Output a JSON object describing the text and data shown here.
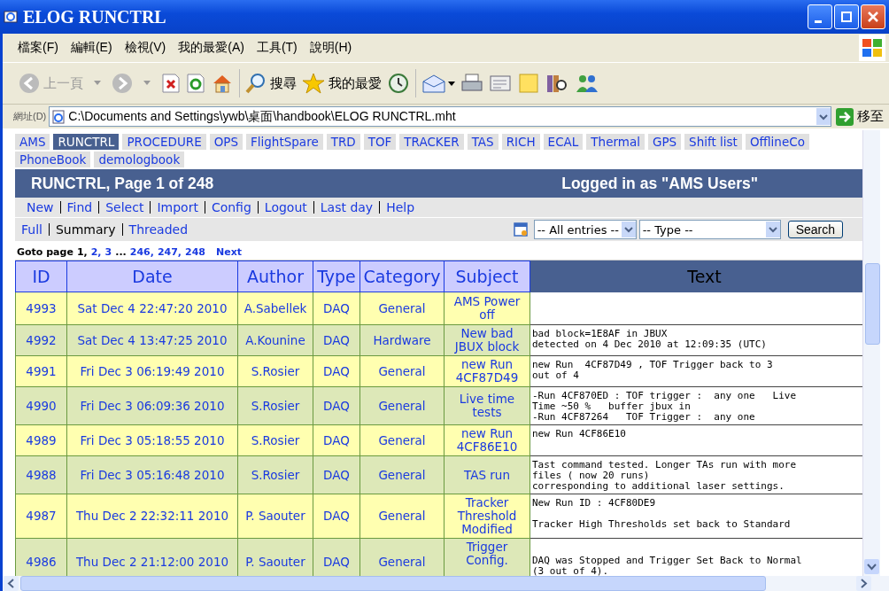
{
  "window": {
    "title": "ELOG RUNCTRL"
  },
  "menu": [
    "檔案(F)",
    "編輯(E)",
    "檢視(V)",
    "我的最愛(A)",
    "工具(T)",
    "說明(H)"
  ],
  "toolbar": {
    "back": {
      "label": "上一頁",
      "disabled": true
    },
    "search": "搜尋",
    "favorites": "我的最愛"
  },
  "address": {
    "label": "網址(D)",
    "value": "C:\\Documents and Settings\\ywb\\桌面\\handbook\\ELOG RUNCTRL.mht",
    "go": "移至"
  },
  "logbooks": [
    {
      "label": "AMS",
      "selected": false
    },
    {
      "label": "RUNCTRL",
      "selected": true
    },
    {
      "label": "PROCEDURE",
      "selected": false
    },
    {
      "label": "OPS",
      "selected": false
    },
    {
      "label": "FlightSpare",
      "selected": false
    },
    {
      "label": "TRD",
      "selected": false
    },
    {
      "label": "TOF",
      "selected": false
    },
    {
      "label": "TRACKER",
      "selected": false
    },
    {
      "label": "TAS",
      "selected": false
    },
    {
      "label": "RICH",
      "selected": false
    },
    {
      "label": "ECAL",
      "selected": false
    },
    {
      "label": "Thermal",
      "selected": false
    },
    {
      "label": "GPS",
      "selected": false
    },
    {
      "label": "Shift list",
      "selected": false
    },
    {
      "label": "OfflineCo",
      "selected": false
    },
    {
      "label": "PhoneBook",
      "selected": false
    },
    {
      "label": "demologbook",
      "selected": false
    }
  ],
  "header": {
    "title": "RUNCTRL, Page 1 of 248",
    "user": "Logged in as \"AMS Users\""
  },
  "commands": [
    "New",
    "Find",
    "Select",
    "Import",
    "Config",
    "Logout",
    "Last day",
    "Help"
  ],
  "views": [
    {
      "label": "Full",
      "selected": false
    },
    {
      "label": "Summary",
      "selected": true
    },
    {
      "label": "Threaded",
      "selected": false
    }
  ],
  "filters": [
    {
      "value": "-- All entries --"
    },
    {
      "value": "-- Type --"
    }
  ],
  "search_button": "Search",
  "goto": {
    "label": "Goto page",
    "pages": [
      {
        "label": "1,",
        "kind": "current"
      },
      {
        "label": "2,",
        "kind": "link"
      },
      {
        "label": "3",
        "kind": "link"
      },
      {
        "label": "...",
        "kind": "gap"
      },
      {
        "label": "246,",
        "kind": "link"
      },
      {
        "label": "247,",
        "kind": "link"
      },
      {
        "label": "248",
        "kind": "link"
      },
      {
        "label": "Next",
        "kind": "next"
      }
    ]
  },
  "table": {
    "columns": [
      "ID",
      "Date",
      "Author",
      "Type",
      "Category",
      "Subject",
      "Text"
    ],
    "rows": [
      {
        "id": "4993",
        "date": "Sat Dec 4 22:47:20 2010",
        "author": "A.Sabellek",
        "type": "DAQ",
        "category": "General",
        "subject": "AMS Power off",
        "text": ""
      },
      {
        "id": "4992",
        "date": "Sat Dec 4 13:47:25 2010",
        "author": "A.Kounine",
        "type": "DAQ",
        "category": "Hardware",
        "subject": "New bad JBUX block",
        "text": "bad block=1E8AF in JBUX\ndetected on 4 Dec 2010 at 12:09:35 (UTC)"
      },
      {
        "id": "4991",
        "date": "Fri Dec 3 06:19:49 2010",
        "author": "S.Rosier",
        "type": "DAQ",
        "category": "General",
        "subject": "new Run 4CF87D49",
        "text": "new Run  4CF87D49 , TOF Trigger back to 3\nout of 4"
      },
      {
        "id": "4990",
        "date": "Fri Dec 3 06:09:36 2010",
        "author": "S.Rosier",
        "type": "DAQ",
        "category": "General",
        "subject": "Live time tests",
        "text": "-Run 4CF870ED : TOF trigger :  any one   Live\nTime ~50 %   buffer jbux in\n-Run 4CF87264   TOF Trigger :  any one"
      },
      {
        "id": "4989",
        "date": "Fri Dec 3 05:18:55 2010",
        "author": "S.Rosier",
        "type": "DAQ",
        "category": "General",
        "subject": "new Run 4CF86E10",
        "text": "new Run 4CF86E10"
      },
      {
        "id": "4988",
        "date": "Fri Dec 3 05:16:48 2010",
        "author": "S.Rosier",
        "type": "DAQ",
        "category": "General",
        "subject": "TAS run",
        "text": "Tast command tested. Longer TAs run with more\nfiles ( now 20 runs)\ncorresponding to additional laser settings."
      },
      {
        "id": "4987",
        "date": "Thu Dec 2 22:32:11 2010",
        "author": "P. Saouter",
        "type": "DAQ",
        "category": "General",
        "subject": "Tracker Threshold Modified",
        "text": "New Run ID : 4CF80DE9\n\nTracker High Thresholds set back to Standard"
      },
      {
        "id": "4986",
        "date": "Thu Dec 2 21:12:00 2010",
        "author": "P. Saouter",
        "type": "DAQ",
        "category": "General",
        "subject": "Trigger Config.",
        "text": "DAQ was Stopped and Trigger Set Back to Normal\n(3 out of 4)."
      }
    ]
  }
}
